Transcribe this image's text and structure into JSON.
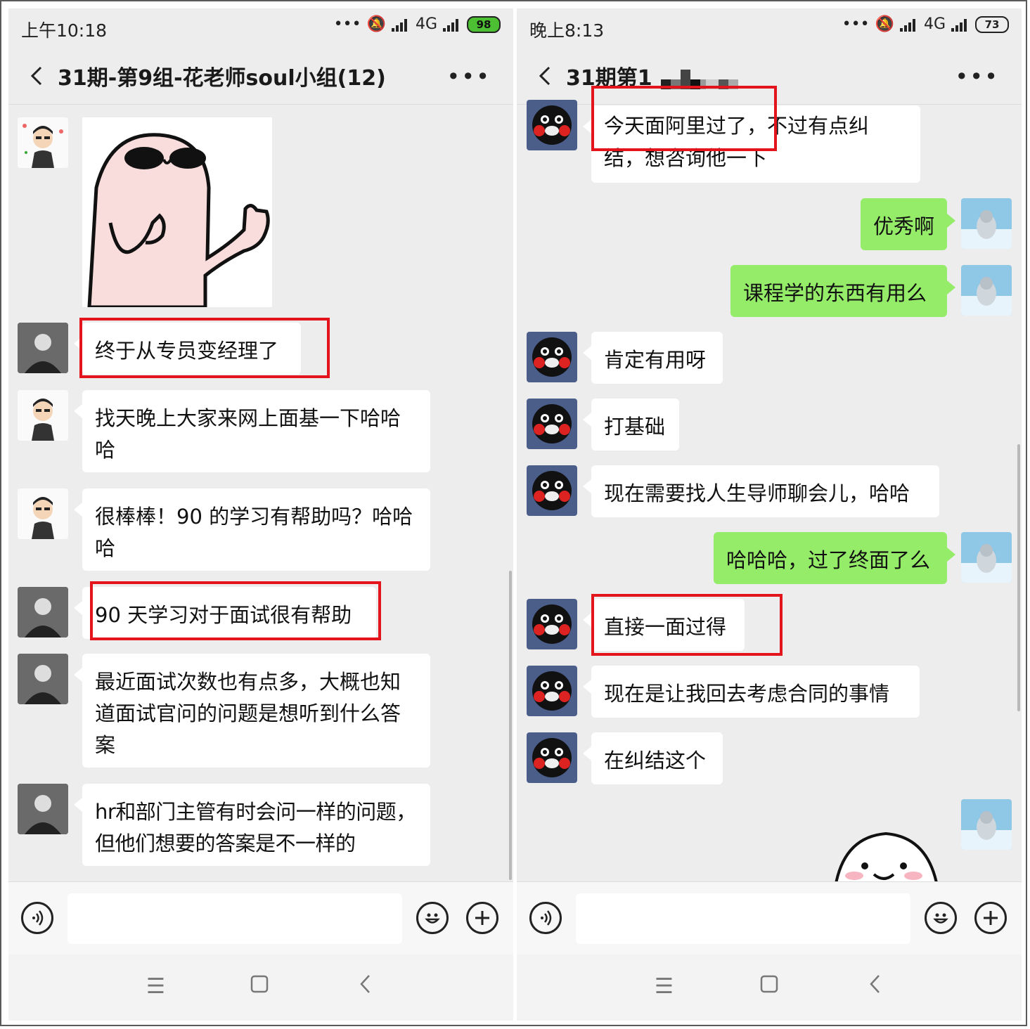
{
  "left": {
    "status": {
      "time": "上午10:18",
      "network": "4G",
      "battery": "98"
    },
    "header": {
      "title": "31期-第9组-花老师soul小组(12)"
    },
    "messages": [
      {
        "text": "终于从专员变经理了"
      },
      {
        "text": "找天晚上大家来网上面基一下哈哈哈"
      },
      {
        "text": "很棒棒！90 的学习有帮助吗？哈哈哈"
      },
      {
        "text": "90 天学习对于面试很有帮助"
      },
      {
        "text": "最近面试次数也有点多，大概也知道面试官问的问题是想听到什么答案"
      },
      {
        "text": "hr和部门主管有时会问一样的问题，但他们想要的答案是不一样的"
      }
    ]
  },
  "right": {
    "status": {
      "time": "晚上8:13",
      "network": "4G",
      "battery": "73"
    },
    "header": {
      "title": "31期第1"
    },
    "messages": [
      {
        "text": "今天面阿里过了，不过有点纠结，想咨询他一下"
      },
      {
        "text": "优秀啊"
      },
      {
        "text": "课程学的东西有用么"
      },
      {
        "text": "肯定有用呀"
      },
      {
        "text": "打基础"
      },
      {
        "text": "现在需要找人生导师聊会儿，哈哈"
      },
      {
        "text": "哈哈哈，过了终面了么"
      },
      {
        "text": "直接一面过得"
      },
      {
        "text": "现在是让我回去考虑合同的事情"
      },
      {
        "text": "在纠结这个"
      }
    ]
  },
  "icons": {
    "voice": "voice-icon",
    "emoji": "emoji-icon",
    "plus": "plus-icon",
    "menu": "menu-icon",
    "home": "home-icon",
    "back": "back-icon",
    "more": "more-icon"
  },
  "colors": {
    "outgoing": "#95ec69",
    "incoming": "#ffffff",
    "highlight": "#e3141c",
    "background": "#ededed"
  }
}
